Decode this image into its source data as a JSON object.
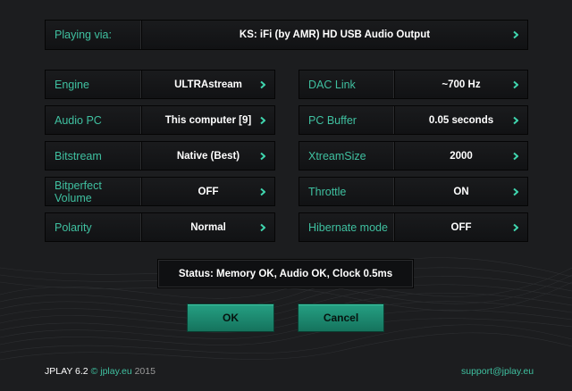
{
  "playing_via": {
    "label": "Playing via:",
    "value": "KS: iFi (by AMR) HD USB Audio Output"
  },
  "left_settings": [
    {
      "label": "Engine",
      "value": "ULTRAstream"
    },
    {
      "label": "Audio PC",
      "value": "This computer [9]"
    },
    {
      "label": "Bitstream",
      "value": "Native (Best)"
    },
    {
      "label": "Bitperfect Volume",
      "value": "OFF"
    },
    {
      "label": "Polarity",
      "value": "Normal"
    }
  ],
  "right_settings": [
    {
      "label": "DAC Link",
      "value": "~700 Hz"
    },
    {
      "label": "PC Buffer",
      "value": "0.05 seconds"
    },
    {
      "label": "XtreamSize",
      "value": "2000"
    },
    {
      "label": "Throttle",
      "value": "ON"
    },
    {
      "label": "Hibernate mode",
      "value": "OFF"
    }
  ],
  "status": "Status: Memory OK, Audio OK, Clock 0.5ms",
  "buttons": {
    "ok": "OK",
    "cancel": "Cancel"
  },
  "footer": {
    "product": "JPLAY 6.2",
    "copyright_symbol": "©",
    "site": "jplay.eu",
    "year": "2015",
    "support": "support@jplay.eu"
  },
  "colors": {
    "accent": "#3fc0a0",
    "background": "#1c1d1f",
    "button": "#1d8a70"
  },
  "icons": {
    "row_arrow": "chevron-right-icon"
  }
}
